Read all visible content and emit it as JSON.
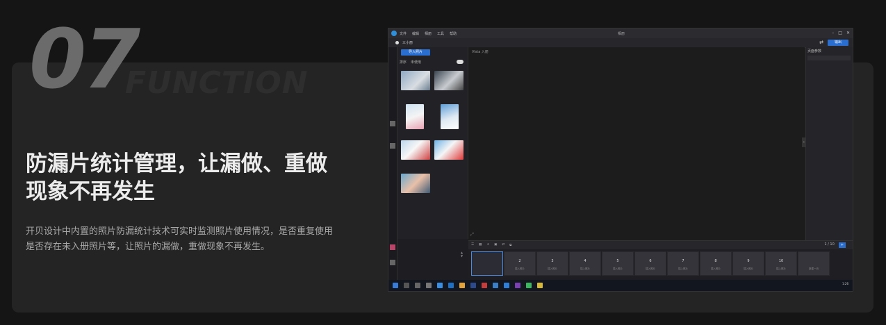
{
  "hero": {
    "number": "07",
    "subtitle": "FUNCTION",
    "headline_line1": "防漏片统计管理，让漏做、重做",
    "headline_line2": "现象不再发生",
    "description_line1": "开贝设计中内置的照片防漏统计技术可实时监测照片使用情况，是否重复使用",
    "description_line2": "是否存在未入册照片等，让照片的漏做，重做现象不再发生。"
  },
  "colors": {
    "background": "#151515",
    "panel": "#242424",
    "accent_blue": "#2a6fd0"
  },
  "app": {
    "menu": [
      "文件",
      "编辑",
      "相册",
      "工具",
      "帮助"
    ],
    "title": "相册",
    "project_name": "三小册",
    "import_button": "导入照片",
    "export_button": "输出",
    "sort_label": "排序",
    "filter_label": "未使用",
    "canvas_note": "Vista 入册",
    "right_panel_title": "页面参数",
    "page_counter": "1 / 10",
    "filmstrip": [
      {
        "n": "",
        "label": ""
      },
      {
        "n": "2",
        "label": "插入照片"
      },
      {
        "n": "3",
        "label": "插入照片"
      },
      {
        "n": "4",
        "label": "插入照片"
      },
      {
        "n": "5",
        "label": "插入照片"
      },
      {
        "n": "6",
        "label": "插入照片"
      },
      {
        "n": "7",
        "label": "插入照片"
      },
      {
        "n": "8",
        "label": "插入照片"
      },
      {
        "n": "9",
        "label": "插入照片"
      },
      {
        "n": "10",
        "label": "插入照片"
      },
      {
        "n": "",
        "label": "新建一页"
      }
    ],
    "clock": "1:26"
  }
}
